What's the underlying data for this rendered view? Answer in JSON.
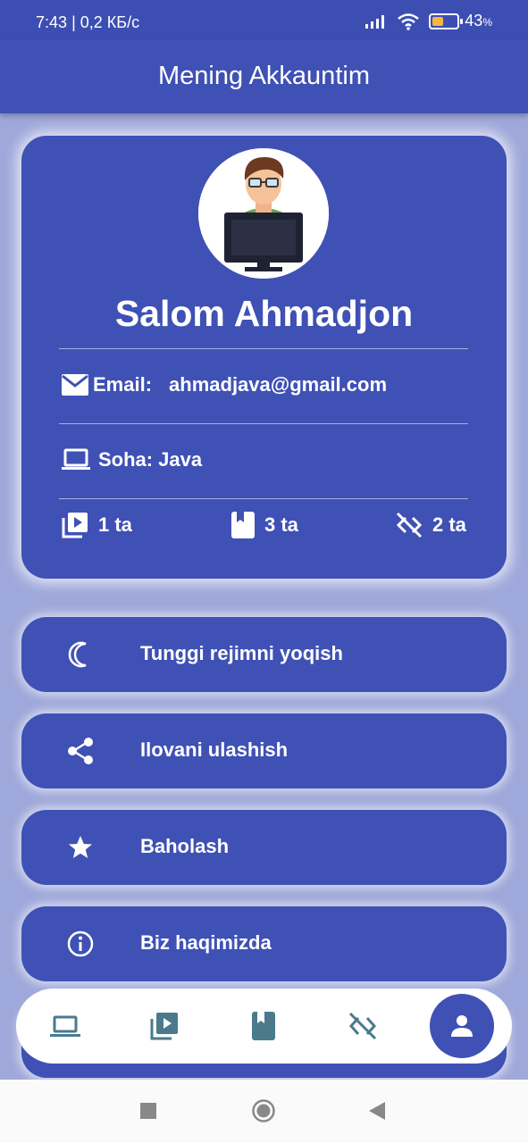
{
  "status_bar": {
    "time": "7:43",
    "network_speed": "0,2 КБ/с",
    "battery_percent": "43",
    "battery_unit": "%"
  },
  "app_bar": {
    "title": "Mening Akkauntim"
  },
  "profile": {
    "name": "Salom Ahmadjon",
    "email_label": "Email:",
    "email_value": "ahmadjava@gmail.com",
    "field_label": "Soha:",
    "field_value": "Java",
    "stats": [
      {
        "icon": "video-library-icon",
        "value": "1 ta"
      },
      {
        "icon": "book-icon",
        "value": "3 ta"
      },
      {
        "icon": "code-off-icon",
        "value": "2 ta"
      }
    ]
  },
  "menu": [
    {
      "icon": "moon-icon",
      "label": "Tunggi rejimni yoqish"
    },
    {
      "icon": "share-icon",
      "label": "Ilovani ulashish"
    },
    {
      "icon": "star-icon",
      "label": "Baholash"
    },
    {
      "icon": "info-icon",
      "label": "Biz haqimizda"
    }
  ],
  "bottom_nav": {
    "items": [
      "laptop-icon",
      "video-library-icon",
      "book-icon",
      "code-off-icon",
      "person-icon"
    ],
    "active": "person-icon",
    "icon_color": "#4a7a8c",
    "accent": "#3f51b5"
  },
  "colors": {
    "primary": "#3f51b5",
    "background": "#9fa8da",
    "battery": "#f5b642"
  }
}
